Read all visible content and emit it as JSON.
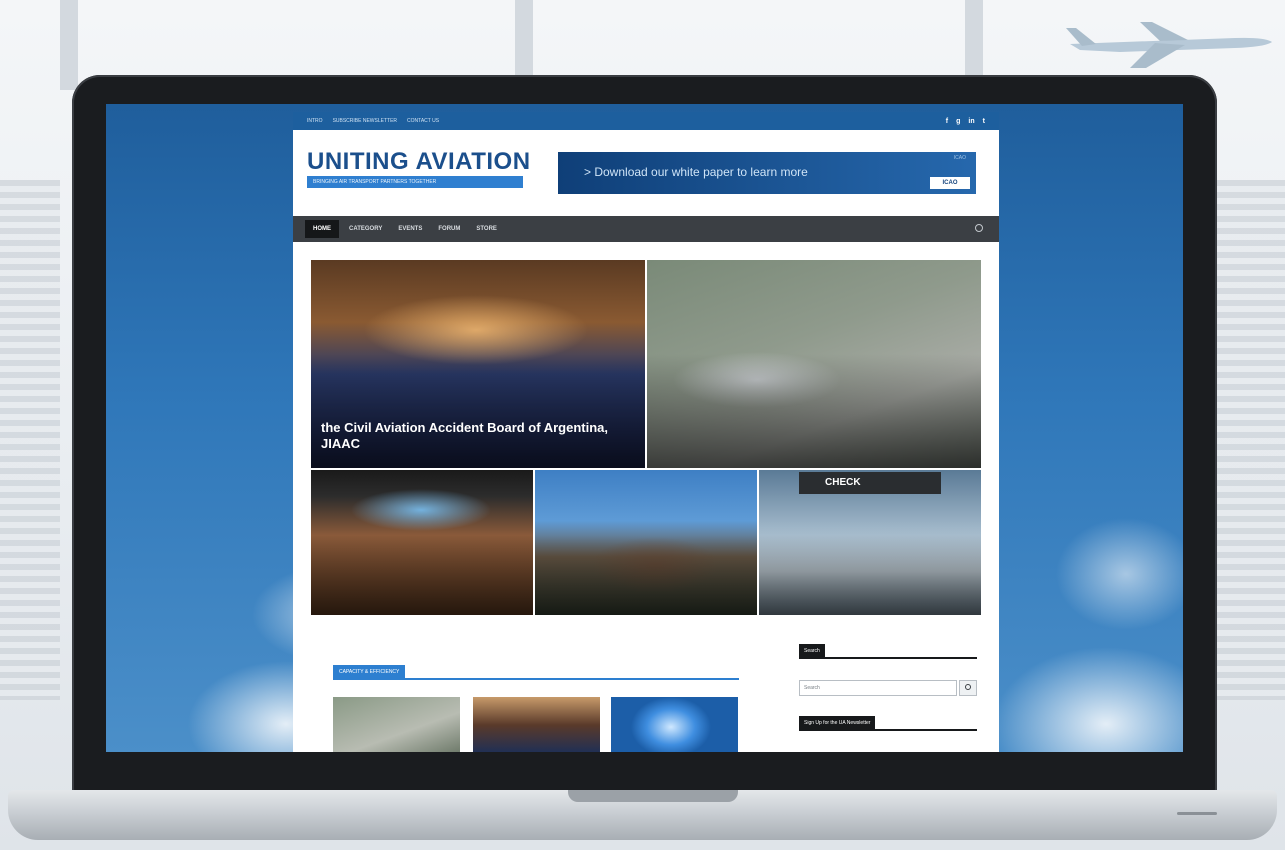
{
  "topbar": {
    "links": [
      "Intro",
      "Subscribe Newsletter",
      "Contact Us"
    ],
    "socials": [
      "f",
      "g",
      "in",
      "t"
    ]
  },
  "logo": {
    "title": "UNITING AVIATION",
    "tagline": "BRINGING AIR TRANSPORT PARTNERS TOGETHER"
  },
  "banner": {
    "text": "> Download our white paper to learn more",
    "button": "ICAO",
    "small": "ICAO"
  },
  "nav": {
    "items": [
      "Home",
      "Category",
      "Events",
      "Forum",
      "Store"
    ],
    "active_index": 0
  },
  "tiles": [
    {
      "category": "",
      "title": "the Civil Aviation Accident Board of Argentina, JIAAC",
      "meta": "",
      "accent": "#2d7fd0"
    },
    {
      "category": "",
      "title": "",
      "meta": "",
      "accent": "#2d7fd0"
    },
    {
      "category": "",
      "title": "",
      "meta": "",
      "accent": "#e07a2a"
    },
    {
      "category": "",
      "title": "",
      "meta": "",
      "accent": "#e0b020"
    },
    {
      "category": "",
      "title": "",
      "meta": "",
      "accent": "#e07a2a"
    }
  ],
  "check_sign": "CHECK",
  "section": {
    "label": "CAPACITY & EFFICIENCY"
  },
  "sidebar": {
    "search_label": "Search",
    "search_placeholder": "Search",
    "newsletter_label": "Sign Up for the UA Newsletter"
  },
  "colors": {
    "brand_blue": "#1b4f8c",
    "topbar_blue": "#1d5f9e",
    "nav_dark": "#3b3f44"
  }
}
